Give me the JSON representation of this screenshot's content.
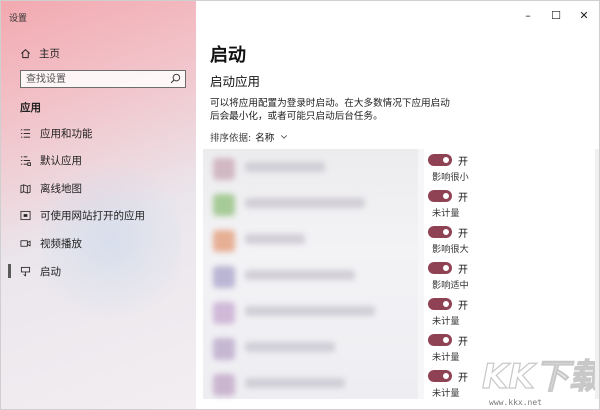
{
  "window": {
    "title": "设置",
    "controls": {
      "minimize": "–",
      "maximize": "☐",
      "close": "✕"
    }
  },
  "sidebar": {
    "home_label": "主页",
    "search_placeholder": "查找设置",
    "section_label": "应用",
    "items": [
      {
        "label": "应用和功能",
        "icon": "apps-list-icon",
        "active": false
      },
      {
        "label": "默认应用",
        "icon": "default-apps-icon",
        "active": false
      },
      {
        "label": "离线地图",
        "icon": "map-icon",
        "active": false
      },
      {
        "label": "可使用网站打开的应用",
        "icon": "website-apps-icon",
        "active": false
      },
      {
        "label": "视频播放",
        "icon": "video-icon",
        "active": false
      },
      {
        "label": "启动",
        "icon": "startup-icon",
        "active": true
      }
    ]
  },
  "main": {
    "page_title": "启动",
    "sub_title": "启动应用",
    "description": "可以将应用配置为登录时启动。在大多数情况下应用启动后会最小化，或者可能只启动后台任务。",
    "sort_label": "排序依据:",
    "sort_value": "名称",
    "startup_apps": [
      {
        "state": "开",
        "impact": "影响很小",
        "on": true,
        "icon_color": "#c9a7b3"
      },
      {
        "state": "开",
        "impact": "未计量",
        "on": true,
        "icon_color": "#8fbf7a"
      },
      {
        "state": "开",
        "impact": "影响很大",
        "on": true,
        "icon_color": "#e39a76"
      },
      {
        "state": "开",
        "impact": "影响适中",
        "on": true,
        "icon_color": "#a9a2c9"
      },
      {
        "state": "开",
        "impact": "未计量",
        "on": true,
        "icon_color": "#c4a6cf"
      },
      {
        "state": "开",
        "impact": "未计量",
        "on": true,
        "icon_color": "#b7a4c8"
      },
      {
        "state": "开",
        "impact": "未计量",
        "on": true,
        "icon_color": "#bfa3c4"
      }
    ]
  },
  "colors": {
    "toggle_on": "#8e4253",
    "sidebar_top": "#f3a9b0"
  },
  "watermark": {
    "logo_text": "KK下载",
    "url": "www.kkx.net"
  }
}
